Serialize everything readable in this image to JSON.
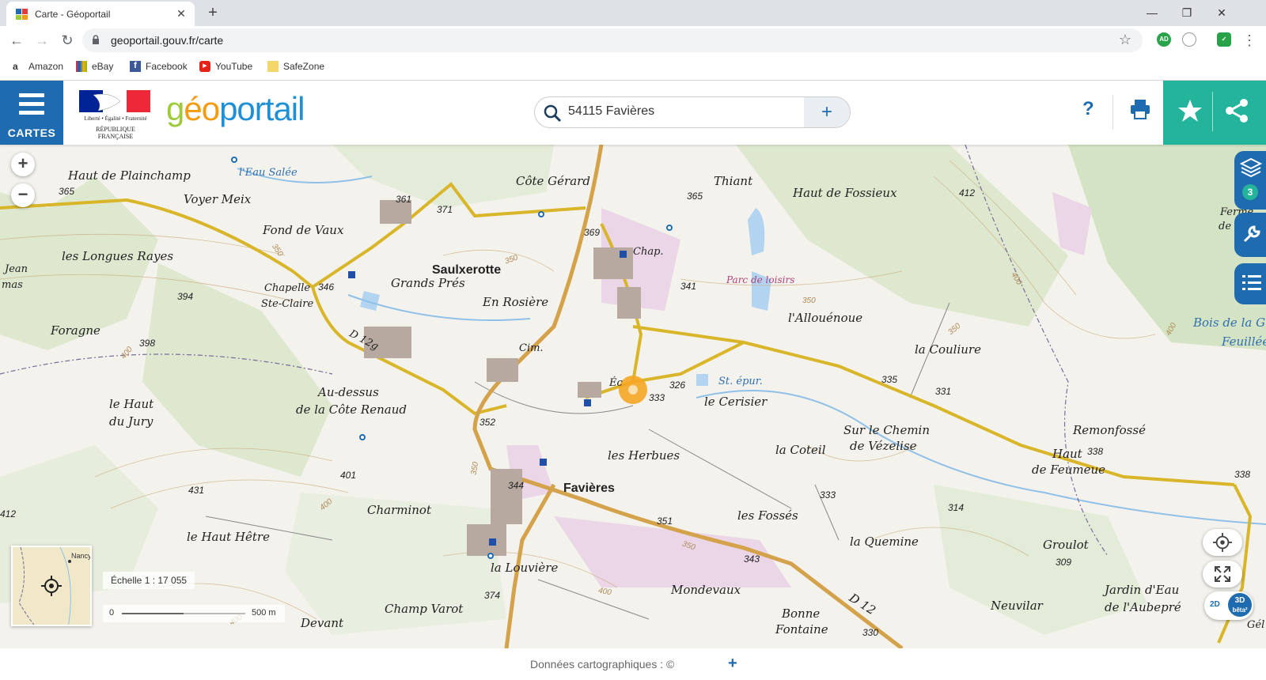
{
  "browser": {
    "tab_title": "Carte - Géoportail",
    "url": "geoportail.gouv.fr/carte",
    "bookmarks": [
      "Amazon",
      "eBay",
      "Facebook",
      "YouTube",
      "SafeZone"
    ],
    "ext_ad": "AD"
  },
  "header": {
    "cartes_label": "CARTES",
    "marianne_motto": "Liberté • Égalité • Fraternité",
    "republique": "RÉPUBLIQUE FRANÇAISE",
    "brand": {
      "g": "g",
      "e": "é",
      "o": "o",
      "rest": "portail"
    },
    "search_value": "54115 Favières",
    "help": "?"
  },
  "map": {
    "places": [
      {
        "name": "Haut de Plainchamp",
        "cls": "med"
      },
      {
        "name": "l'Eau Salée",
        "cls": "small blue"
      },
      {
        "name": "Voyer Meix",
        "cls": "med"
      },
      {
        "name": "Côte Gérard",
        "cls": "med"
      },
      {
        "name": "Thiant",
        "cls": "med"
      },
      {
        "name": "Haut de Fossieux",
        "cls": "med"
      },
      {
        "name": "Fond de Vaux",
        "cls": "med"
      },
      {
        "name": "les Longues Rayes",
        "cls": "med"
      },
      {
        "name": "Saulxerotte",
        "cls": "big"
      },
      {
        "name": "Grands Prés",
        "cls": "med"
      },
      {
        "name": "En Rosière",
        "cls": "med"
      },
      {
        "name": "Chapelle",
        "cls": "small"
      },
      {
        "name": "Ste-Claire",
        "cls": "small"
      },
      {
        "name": "Parc de loisirs",
        "cls": "pink"
      },
      {
        "name": "l'Allouénoue",
        "cls": "med"
      },
      {
        "name": "Foragne",
        "cls": "med"
      },
      {
        "name": "D 12g",
        "cls": "small"
      },
      {
        "name": "la Couliure",
        "cls": "med"
      },
      {
        "name": "Bois de la G",
        "cls": "med blue"
      },
      {
        "name": "Feuillée",
        "cls": "med blue"
      },
      {
        "name": "Cim.",
        "cls": "small"
      },
      {
        "name": "St. épur.",
        "cls": "small blue"
      },
      {
        "name": "le Cerisier",
        "cls": "med"
      },
      {
        "name": "Au-dessus",
        "cls": "med"
      },
      {
        "name": "de la Côte Renaud",
        "cls": "med"
      },
      {
        "name": "le Haut",
        "cls": "med"
      },
      {
        "name": "du Jury",
        "cls": "med"
      },
      {
        "name": "Sur le Chemin",
        "cls": "med"
      },
      {
        "name": "de Vézelise",
        "cls": "med"
      },
      {
        "name": "Remonfossé",
        "cls": "med"
      },
      {
        "name": "les Herbues",
        "cls": "med"
      },
      {
        "name": "la Coteil",
        "cls": "med"
      },
      {
        "name": "Haut",
        "cls": "med"
      },
      {
        "name": "de Feumeue",
        "cls": "med"
      },
      {
        "name": "Favières",
        "cls": "big"
      },
      {
        "name": "Charminot",
        "cls": "med"
      },
      {
        "name": "les Fossés",
        "cls": "med"
      },
      {
        "name": "le Haut Hêtre",
        "cls": "med"
      },
      {
        "name": "la Quemine",
        "cls": "med"
      },
      {
        "name": "Groulot",
        "cls": "med"
      },
      {
        "name": "la Louvière",
        "cls": "med"
      },
      {
        "name": "Mondevaux",
        "cls": "med"
      },
      {
        "name": "Jardin d'Eau",
        "cls": "med"
      },
      {
        "name": "de l'Aubepré",
        "cls": "med"
      },
      {
        "name": "Champ Varot",
        "cls": "med"
      },
      {
        "name": "Bonne",
        "cls": "med"
      },
      {
        "name": "Fontaine",
        "cls": "med"
      },
      {
        "name": "Neuvilar",
        "cls": "med"
      },
      {
        "name": "Devant",
        "cls": "med"
      },
      {
        "name": "D 12",
        "cls": "med"
      },
      {
        "name": "Chap.",
        "cls": "small"
      },
      {
        "name": "Ferme",
        "cls": "small"
      },
      {
        "name": "de la",
        "cls": "small"
      },
      {
        "name": "Gél",
        "cls": "small"
      },
      {
        "name": "Jean",
        "cls": "small"
      },
      {
        "name": "mas",
        "cls": "small"
      },
      {
        "name": "Éc",
        "cls": "small"
      }
    ],
    "altitudes": [
      "365",
      "361",
      "371",
      "369",
      "365",
      "412",
      "394",
      "346",
      "341",
      "398",
      "326",
      "333",
      "335",
      "331",
      "352",
      "401",
      "344",
      "333",
      "338",
      "338",
      "431",
      "412",
      "351",
      "314",
      "343",
      "309",
      "374",
      "330"
    ],
    "contour_labels": [
      "350",
      "350",
      "400",
      "400",
      "350",
      "350",
      "400",
      "350",
      "400",
      "350",
      "400",
      "400"
    ],
    "overview_city": "Nancy",
    "scale_text": "Échelle 1 : 17 055",
    "scale_zero": "0",
    "scale_max": "500 m",
    "layers_count": "3",
    "btn_2d": "2D",
    "btn_3d": "3D",
    "btn_3d_sub": "bêta²"
  },
  "footer": {
    "credits": "Données cartographiques : ©"
  }
}
